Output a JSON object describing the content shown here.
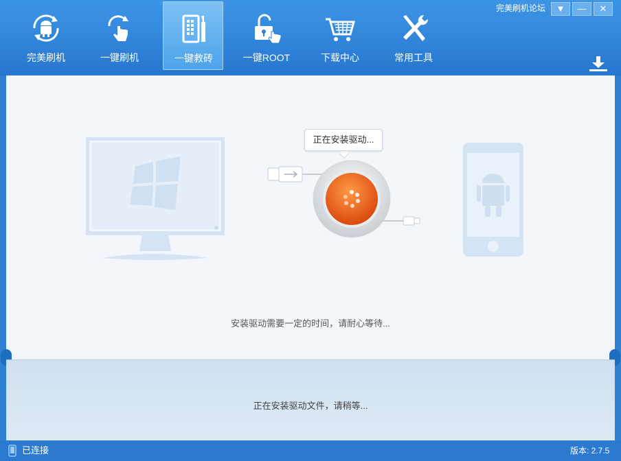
{
  "window": {
    "forum_link": "完美刷机论坛",
    "menu_glyph": "▼",
    "minimize_glyph": "—",
    "close_glyph": "✕"
  },
  "nav": {
    "items": [
      {
        "label": "完美刷机",
        "icon": "android-refresh-icon"
      },
      {
        "label": "一键刷机",
        "icon": "touch-refresh-icon"
      },
      {
        "label": "一键救砖",
        "icon": "phone-repair-icon",
        "active": true
      },
      {
        "label": "一键ROOT",
        "icon": "unlock-icon"
      },
      {
        "label": "下载中心",
        "icon": "shopping-cart-icon"
      },
      {
        "label": "常用工具",
        "icon": "tools-icon"
      }
    ]
  },
  "main": {
    "bubble_text": "正在安装驱动...",
    "hint": "安装驱动需要一定的时间，请耐心等待..."
  },
  "bottom": {
    "progress_text": "正在安装驱动文件，请稍等..."
  },
  "status": {
    "connection": "已连接",
    "version": "版本: 2.7.5"
  },
  "colors": {
    "header_blue": "#2f7fd3",
    "orange_button": "#e8621a",
    "panel_bg": "#f3f7fb"
  }
}
